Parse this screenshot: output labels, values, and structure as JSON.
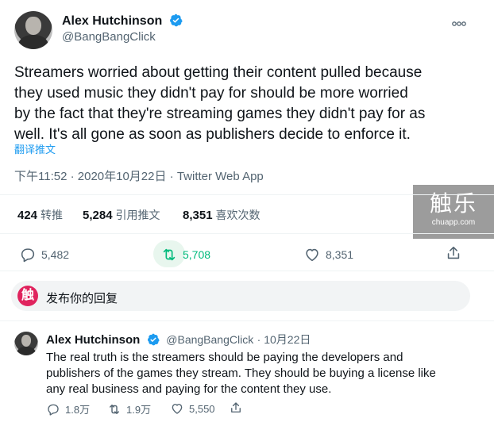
{
  "tweet": {
    "author_name": "Alex Hutchinson",
    "author_handle": "@BangBangClick",
    "more_icon": "more-horizontal",
    "text_lines": [
      "Streamers worried about getting their content pulled because",
      "they used music they didn't pay for should be more worried",
      "by the fact that they're streaming games they didn't pay for as",
      "well. It's all gone as soon as publishers decide to enforce it."
    ],
    "translate_label": "翻译推文",
    "meta": "下午11:52 · 2020年10月22日 · Twitter Web App"
  },
  "stats": [
    {
      "value": "424",
      "label": "转推"
    },
    {
      "value": "5,284",
      "label": "引用推文"
    },
    {
      "value": "8,351",
      "label": "喜欢次数"
    }
  ],
  "actions": {
    "reply_count": "5,482",
    "retweet_count": "5,708",
    "like_count": "8,351"
  },
  "watermark": {
    "main": "触乐",
    "sub": "chuapp.com"
  },
  "reply_box": {
    "avatar_char": "触",
    "placeholder": "发布你的回复"
  },
  "reply": {
    "author_name": "Alex Hutchinson",
    "author_handle": "@BangBangClick",
    "date": "· 10月22日",
    "text_lines": [
      "The real truth is the streamers should be paying the developers and",
      "publishers of the games they stream. They should be buying a license like",
      "any real business and paying for the content they use."
    ],
    "reply_count": "1.8万",
    "retweet_count": "1.9万",
    "like_count": "5,550"
  },
  "colors": {
    "accent": "#1d9bf0",
    "retweet": "#00ba7c",
    "brand_red": "#e0245e"
  }
}
